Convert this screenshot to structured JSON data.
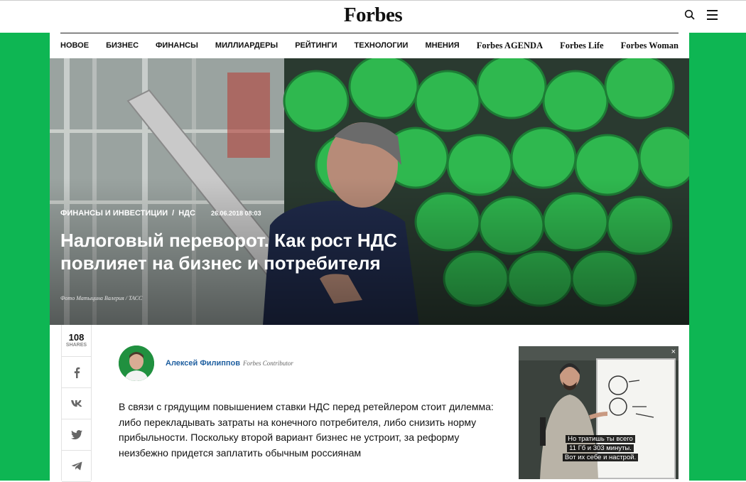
{
  "header": {
    "logo": "Forbes"
  },
  "nav": {
    "items": [
      "НОВОЕ",
      "БИЗНЕС",
      "ФИНАНСЫ",
      "МИЛЛИАРДЕРЫ",
      "РЕЙТИНГИ",
      "ТЕХНОЛОГИИ",
      "МНЕНИЯ"
    ],
    "brands": [
      "Forbes AGENDA",
      "Forbes Life",
      "Forbes Woman"
    ]
  },
  "article": {
    "category": "ФИНАНСЫ И ИНВЕСТИЦИИ",
    "separator": "/",
    "tag": "НДС",
    "date": "26.06.2018 08:03",
    "title": "Налоговый переворот. Как рост НДС повлияет на бизнес и потребителя",
    "photo_credit": "Фото Матыцина Валерия / ТАСС",
    "lead": "В связи с грядущим повышением ставки НДС перед ретейлером стоит дилемма: либо перекладывать затраты на конечного потребителя, либо снизить норму прибыльности. Поскольку второй вариант бизнес не устроит, за реформу неизбежно придется заплатить обычным россиянам"
  },
  "share": {
    "count": "108",
    "label": "SHARES",
    "buttons": [
      "facebook",
      "vk",
      "twitter",
      "telegram"
    ]
  },
  "author": {
    "name": "Алексей Филиппов",
    "role": "Forbes Contributor"
  },
  "video": {
    "close": "×",
    "subtitle_lines": [
      "Но тратишь ты всего",
      "11 Гб и 303 минуты.",
      "Вот их себе и настрой."
    ]
  },
  "colors": {
    "brand_green": "#0eb653",
    "author_link": "#1f5fa0"
  }
}
